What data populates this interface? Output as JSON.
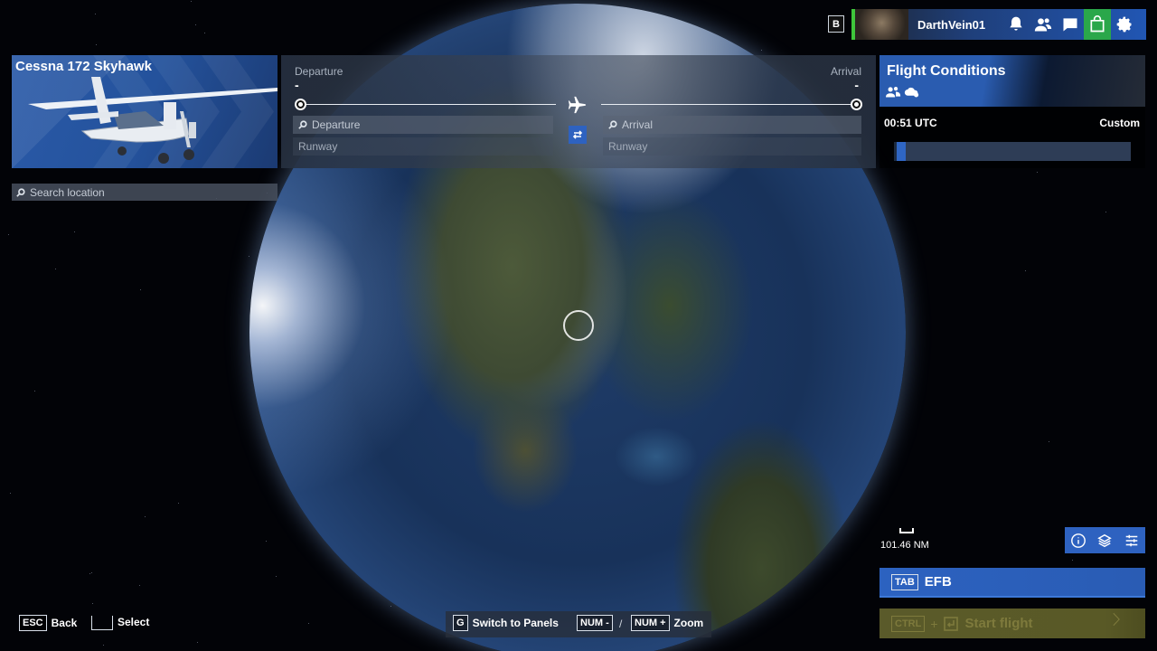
{
  "user": {
    "b_key": "B",
    "username": "DarthVein01",
    "icons": [
      "bell-icon",
      "friends-icon",
      "chat-icon",
      "store-icon",
      "settings-icon"
    ]
  },
  "aircraft": {
    "name": "Cessna 172 Skyhawk"
  },
  "route": {
    "departure_heading": "Departure",
    "arrival_heading": "Arrival",
    "departure_value": "-",
    "arrival_value": "-",
    "departure_placeholder": "Departure",
    "arrival_placeholder": "Arrival",
    "departure_runway": "Runway",
    "arrival_runway": "Runway"
  },
  "search": {
    "placeholder": "Search location"
  },
  "conditions": {
    "title": "Flight Conditions",
    "time": "00:51 UTC",
    "mode": "Custom",
    "time_slider_fraction": 0.05
  },
  "map": {
    "scale_label": "101.46 NM",
    "tools": [
      "info-icon",
      "layers-icon",
      "filters-icon"
    ]
  },
  "efb": {
    "key": "TAB",
    "label": "EFB"
  },
  "start_flight": {
    "key": "CTRL",
    "plus": "+",
    "label": "Start flight"
  },
  "hints": {
    "esc_key": "ESC",
    "back_label": "Back",
    "select_label": "Select",
    "g_key": "G",
    "switch_label": "Switch to Panels",
    "num_minus_key": "NUM -",
    "slash": "/",
    "num_plus_key": "NUM +",
    "zoom_label": "Zoom"
  },
  "colors": {
    "accent_blue": "#2e62c0",
    "store_green": "#2aa74a",
    "start_disabled": "#595926"
  }
}
